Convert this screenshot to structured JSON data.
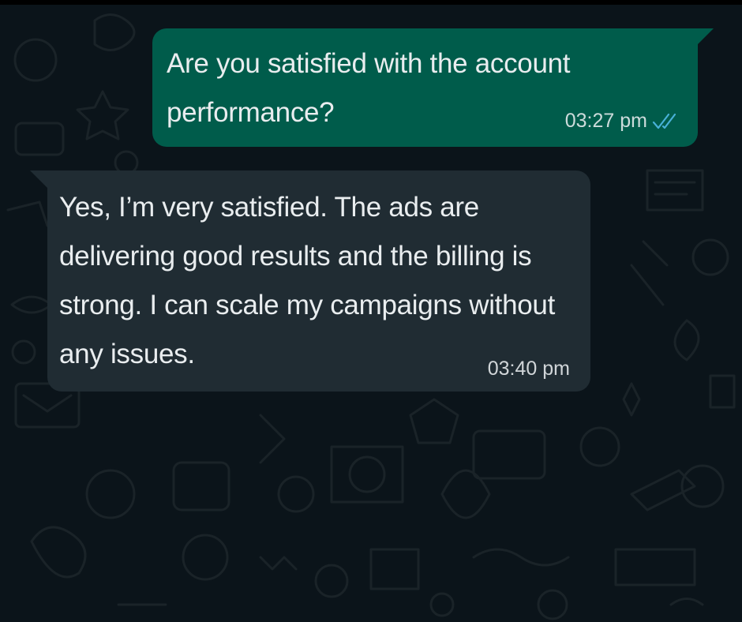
{
  "chat": {
    "background_color": "#0b141a",
    "messages": [
      {
        "direction": "outgoing",
        "text": "Are you satisfied with the account performance?",
        "time": "03:27 pm",
        "status_icon": "double-check-read-icon",
        "bubble_color": "#005c4b",
        "status_color": "#53bdeb"
      },
      {
        "direction": "incoming",
        "text": "Yes, I’m very satisfied. The ads are delivering good results and the billing is strong. I can scale my campaigns without any issues.",
        "time": "03:40 pm",
        "bubble_color": "#202c33"
      }
    ]
  }
}
